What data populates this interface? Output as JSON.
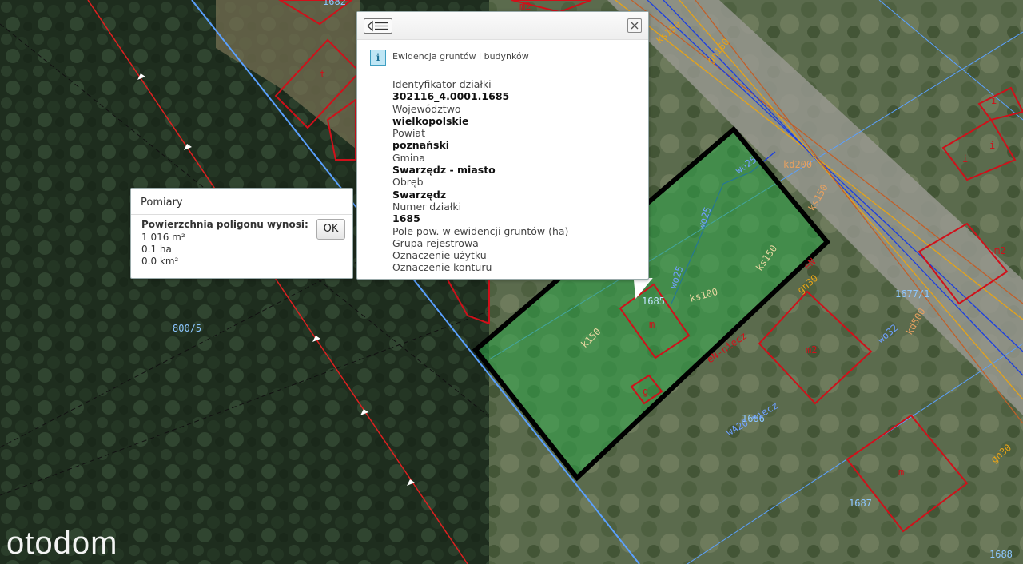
{
  "map": {
    "parcel_label_main": "1685",
    "parcel_label_left": "800/5",
    "parcel_label_east": "1677/1",
    "parcel_label_south": "1687",
    "parcel_label_se": "1688",
    "parcel_label_south2": "1686",
    "parcel_label_top": "1682",
    "building_labels": [
      "m",
      "m2",
      "m2",
      "m2",
      "m",
      "g",
      "t",
      "i",
      "i",
      "i"
    ],
    "utility_labels": [
      "ks150",
      "ks150",
      "ks100",
      "kd200",
      "kd500",
      "wo25",
      "wo25",
      "wo25",
      "wo32",
      "k150",
      "gn160",
      "gn30",
      "gn30",
      "eN",
      "ks150",
      "eN-niecz",
      "wA20 niecz"
    ]
  },
  "info_popup": {
    "layer_title": "Ewidencja gruntów i budynków",
    "attributes": [
      {
        "label": "Identyfikator działki",
        "value": "302116_4.0001.1685"
      },
      {
        "label": "Województwo",
        "value": "wielkopolskie"
      },
      {
        "label": "Powiat",
        "value": "poznański"
      },
      {
        "label": "Gmina",
        "value": "Swarzędz - miasto"
      },
      {
        "label": "Obręb",
        "value": "Swarzędz"
      },
      {
        "label": "Numer działki",
        "value": "1685"
      },
      {
        "label": "Pole pow. w ewidencji gruntów (ha)",
        "value": ""
      },
      {
        "label": "Grupa rejestrowa",
        "value": ""
      },
      {
        "label": "Oznaczenie użytku",
        "value": ""
      },
      {
        "label": "Oznaczenie konturu",
        "value": ""
      }
    ]
  },
  "measure": {
    "title": "Pomiary",
    "label": "Powierzchnia poligonu wynosi:",
    "area_m2": "1 016 m²",
    "area_ha": "0.1 ha",
    "area_km2": "0.0 km²",
    "ok_label": "OK"
  },
  "watermark": "otodom",
  "colors": {
    "parcel_outline": "#000000",
    "building_outline": "#d0101a",
    "gas_line": "#e6a318",
    "water_line": "#1c3fe0",
    "sewer_line": "#c0602a",
    "boundary_line": "#5aa0ff",
    "selection_fill": "#2fa84a"
  }
}
